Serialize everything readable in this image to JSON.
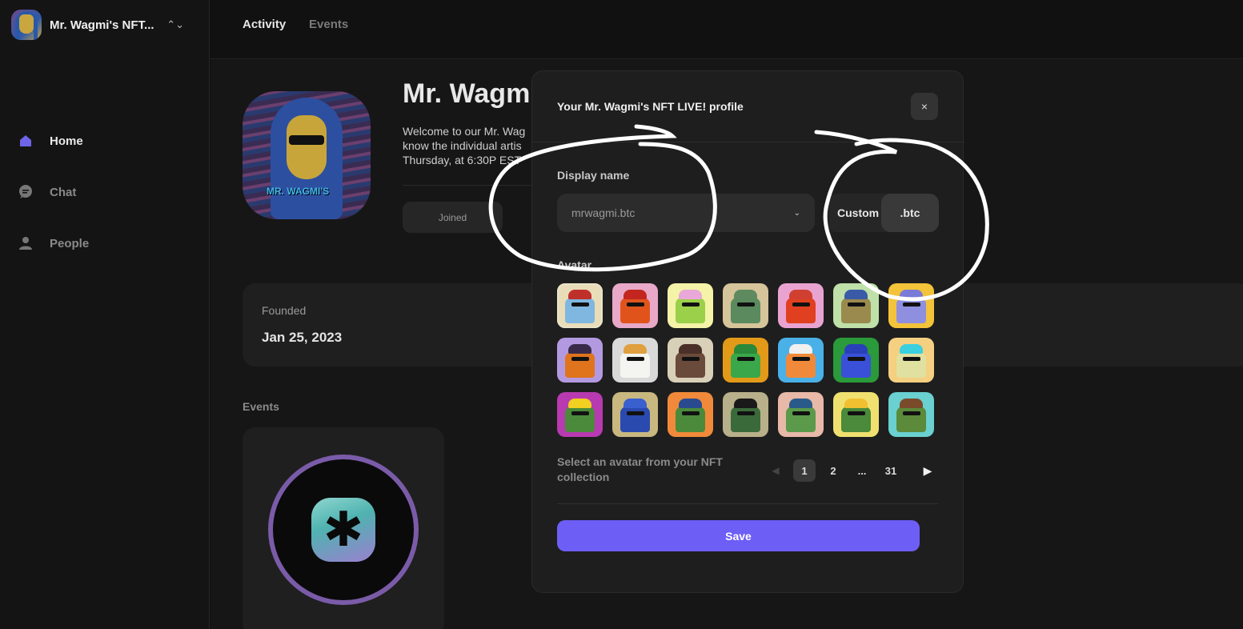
{
  "community": {
    "name": "Mr. Wagmi's NFT...",
    "switch_icon": "updown-chevron-icon"
  },
  "sidebar": {
    "items": [
      {
        "label": "Home",
        "icon": "home-icon",
        "active": true
      },
      {
        "label": "Chat",
        "icon": "chat-icon",
        "active": false
      },
      {
        "label": "People",
        "icon": "person-icon",
        "active": false
      }
    ]
  },
  "topbar": {
    "tabs": [
      {
        "label": "Activity",
        "active": true
      },
      {
        "label": "Events",
        "active": false
      }
    ]
  },
  "hero": {
    "title": "Mr. Wagmi",
    "desc_line1": "Welcome to our Mr. Wag",
    "desc_line2": "know the individual artis",
    "desc_line3": "Thursday, at 6:30P EST",
    "image_text": "MR. WAGMI'S",
    "joined_label": "Joined"
  },
  "founded": {
    "label": "Founded",
    "value": "Jan 25, 2023"
  },
  "events": {
    "label": "Events",
    "card_glyph": "✱"
  },
  "modal": {
    "title": "Your Mr. Wagmi's NFT LIVE! profile",
    "close_label": "×",
    "display_name_label": "Display name",
    "display_name_value": "mrwagmi.btc",
    "dropdown_icon": "⌄",
    "custom_label": "Custom",
    "custom_suffix": ".btc",
    "avatar_label": "Avatar",
    "helper_text": "Select an avatar from your NFT collection",
    "pager": {
      "prev": "◀",
      "pages": [
        "1",
        "2",
        "...",
        "31"
      ],
      "current": "1",
      "next": "▶"
    },
    "save_label": "Save",
    "avatars": [
      {
        "bg": "#e9dcb9",
        "body": "#7fb7e0",
        "hat": "#c0302a",
        "selected": true
      },
      {
        "bg": "#e8a9c8",
        "body": "#e0541c",
        "hat": "#c2261e",
        "selected": false
      },
      {
        "bg": "#f4f3a8",
        "body": "#9bd04a",
        "hat": "#e9a8d8",
        "selected": false
      },
      {
        "bg": "#d6c49a",
        "body": "#5a8a5e",
        "hat": "#5f8a60",
        "selected": false
      },
      {
        "bg": "#e9a3d1",
        "body": "#e0401f",
        "hat": "#d04030",
        "selected": false
      },
      {
        "bg": "#bfe0a8",
        "body": "#9a8a4e",
        "hat": "#3a5aa8",
        "selected": false
      },
      {
        "bg": "#f3c33a",
        "body": "#8f8fe0",
        "hat": "#7a7ad8",
        "selected": false
      },
      {
        "bg": "#b39ae0",
        "body": "#e0741c",
        "hat": "#3a2a4a",
        "selected": false
      },
      {
        "bg": "#d9d9d9",
        "body": "#f4f4f0",
        "hat": "#e0a040",
        "selected": false
      },
      {
        "bg": "#d8d0b8",
        "body": "#6a4a3a",
        "hat": "#4a3028",
        "selected": false
      },
      {
        "bg": "#e39a18",
        "body": "#3aa84a",
        "hat": "#2a8a3a",
        "selected": false
      },
      {
        "bg": "#4ab0e8",
        "body": "#f08a3a",
        "hat": "#f0f0f0",
        "selected": false
      },
      {
        "bg": "#2a9a3a",
        "body": "#3a50d8",
        "hat": "#2a40b8",
        "selected": false
      },
      {
        "bg": "#f4d080",
        "body": "#e0e0a0",
        "hat": "#3ad0e0",
        "selected": false
      },
      {
        "bg": "#b83ab0",
        "body": "#4a8a3a",
        "hat": "#f0d020",
        "selected": false
      },
      {
        "bg": "#c8b880",
        "body": "#2a4ab0",
        "hat": "#3a60d0",
        "selected": false
      },
      {
        "bg": "#f08a3a",
        "body": "#4a8a3a",
        "hat": "#2a4a90",
        "selected": false
      },
      {
        "bg": "#b8b08a",
        "body": "#3a6a3a",
        "hat": "#1a1a1a",
        "selected": false
      },
      {
        "bg": "#e8b8a8",
        "body": "#5a9a4a",
        "hat": "#2a5a8a",
        "selected": false
      },
      {
        "bg": "#f0e070",
        "body": "#4a8a3a",
        "hat": "#f0c030",
        "selected": false
      },
      {
        "bg": "#6ad0d0",
        "body": "#5a8a3a",
        "hat": "#7a4a2a",
        "selected": false
      }
    ]
  },
  "colors": {
    "accent": "#6d5ef5",
    "home_active": "#6e64e8",
    "annotation": "#ffffff"
  }
}
